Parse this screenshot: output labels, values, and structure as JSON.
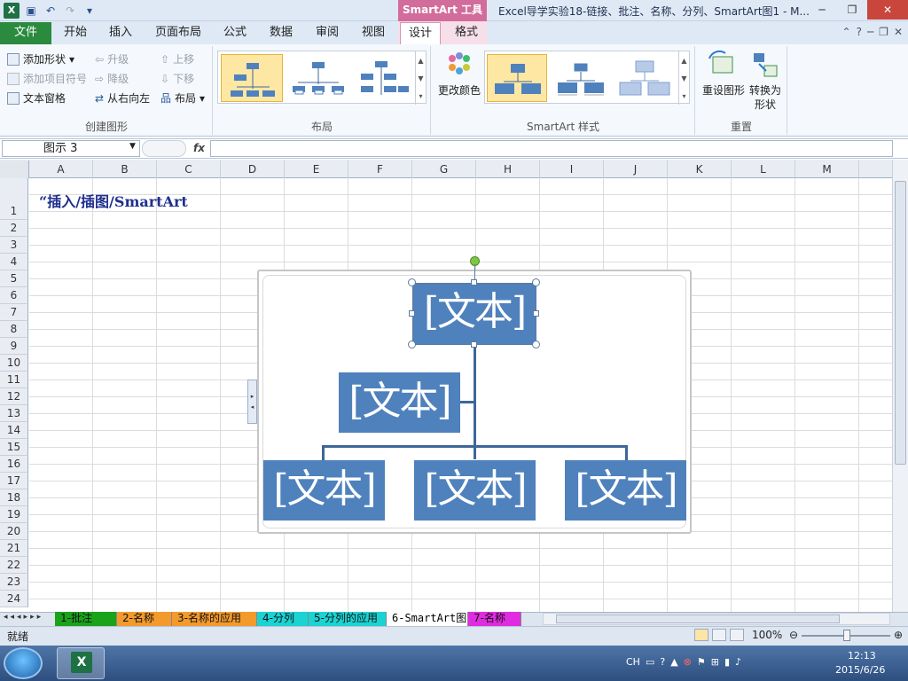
{
  "window": {
    "title": "Excel导学实验18-链接、批注、名称、分列、SmartArt图1 - M...",
    "context_tab_title": "SmartArt 工具",
    "qat_more": "▾"
  },
  "tabs": {
    "file": "文件",
    "items": [
      "开始",
      "插入",
      "页面布局",
      "公式",
      "数据",
      "审阅",
      "视图"
    ],
    "design": "设计",
    "format": "格式"
  },
  "ribbon": {
    "create": {
      "add_shape": "添加形状",
      "add_bullet": "添加项目符号",
      "text_pane": "文本窗格",
      "promote": "升级",
      "demote": "降级",
      "rtl": "从右向左",
      "move_up": "上移",
      "move_down": "下移",
      "layout": "布局",
      "label": "创建图形"
    },
    "layout_label": "布局",
    "change_colors": "更改颜色",
    "style_label": "SmartArt 样式",
    "reset_graphic": "重设图形",
    "convert_line1": "转换为",
    "convert_line2": "形状",
    "reset_label": "重置"
  },
  "formula_bar": {
    "name_box": "图示 3",
    "fx": "fx",
    "value": ""
  },
  "columns": [
    "A",
    "B",
    "C",
    "D",
    "E",
    "F",
    "G",
    "H",
    "I",
    "J",
    "K",
    "L",
    "M"
  ],
  "rows": [
    "1",
    "2",
    "3",
    "4",
    "5",
    "6",
    "7",
    "8",
    "9",
    "10",
    "11",
    "12",
    "13",
    "14",
    "15",
    "16",
    "17",
    "18",
    "19",
    "20",
    "21",
    "22",
    "23",
    "24"
  ],
  "cell_a1": "“插入/插图/SmartArt",
  "smartart": {
    "nodes": [
      "[文本]",
      "[文本]",
      "[文本]",
      "[文本]",
      "[文本]"
    ]
  },
  "sheet_tabs": [
    {
      "label": "1-批注",
      "color": "#1aa31a"
    },
    {
      "label": "2-名称",
      "color": "#f39a2d"
    },
    {
      "label": "3-名称的应用",
      "color": "#f39a2d"
    },
    {
      "label": "4-分列",
      "color": "#1cd3d3"
    },
    {
      "label": "5-分列的应用",
      "color": "#1cd3d3"
    },
    {
      "label": "6-SmartArt图",
      "color": "#ffffff"
    },
    {
      "label": "7-名称",
      "color": "#e02ce0"
    }
  ],
  "status": {
    "ready": "就绪",
    "zoom": "100%"
  },
  "taskbar": {
    "lang": "CH",
    "time": "12:13",
    "date": "2015/6/26"
  }
}
